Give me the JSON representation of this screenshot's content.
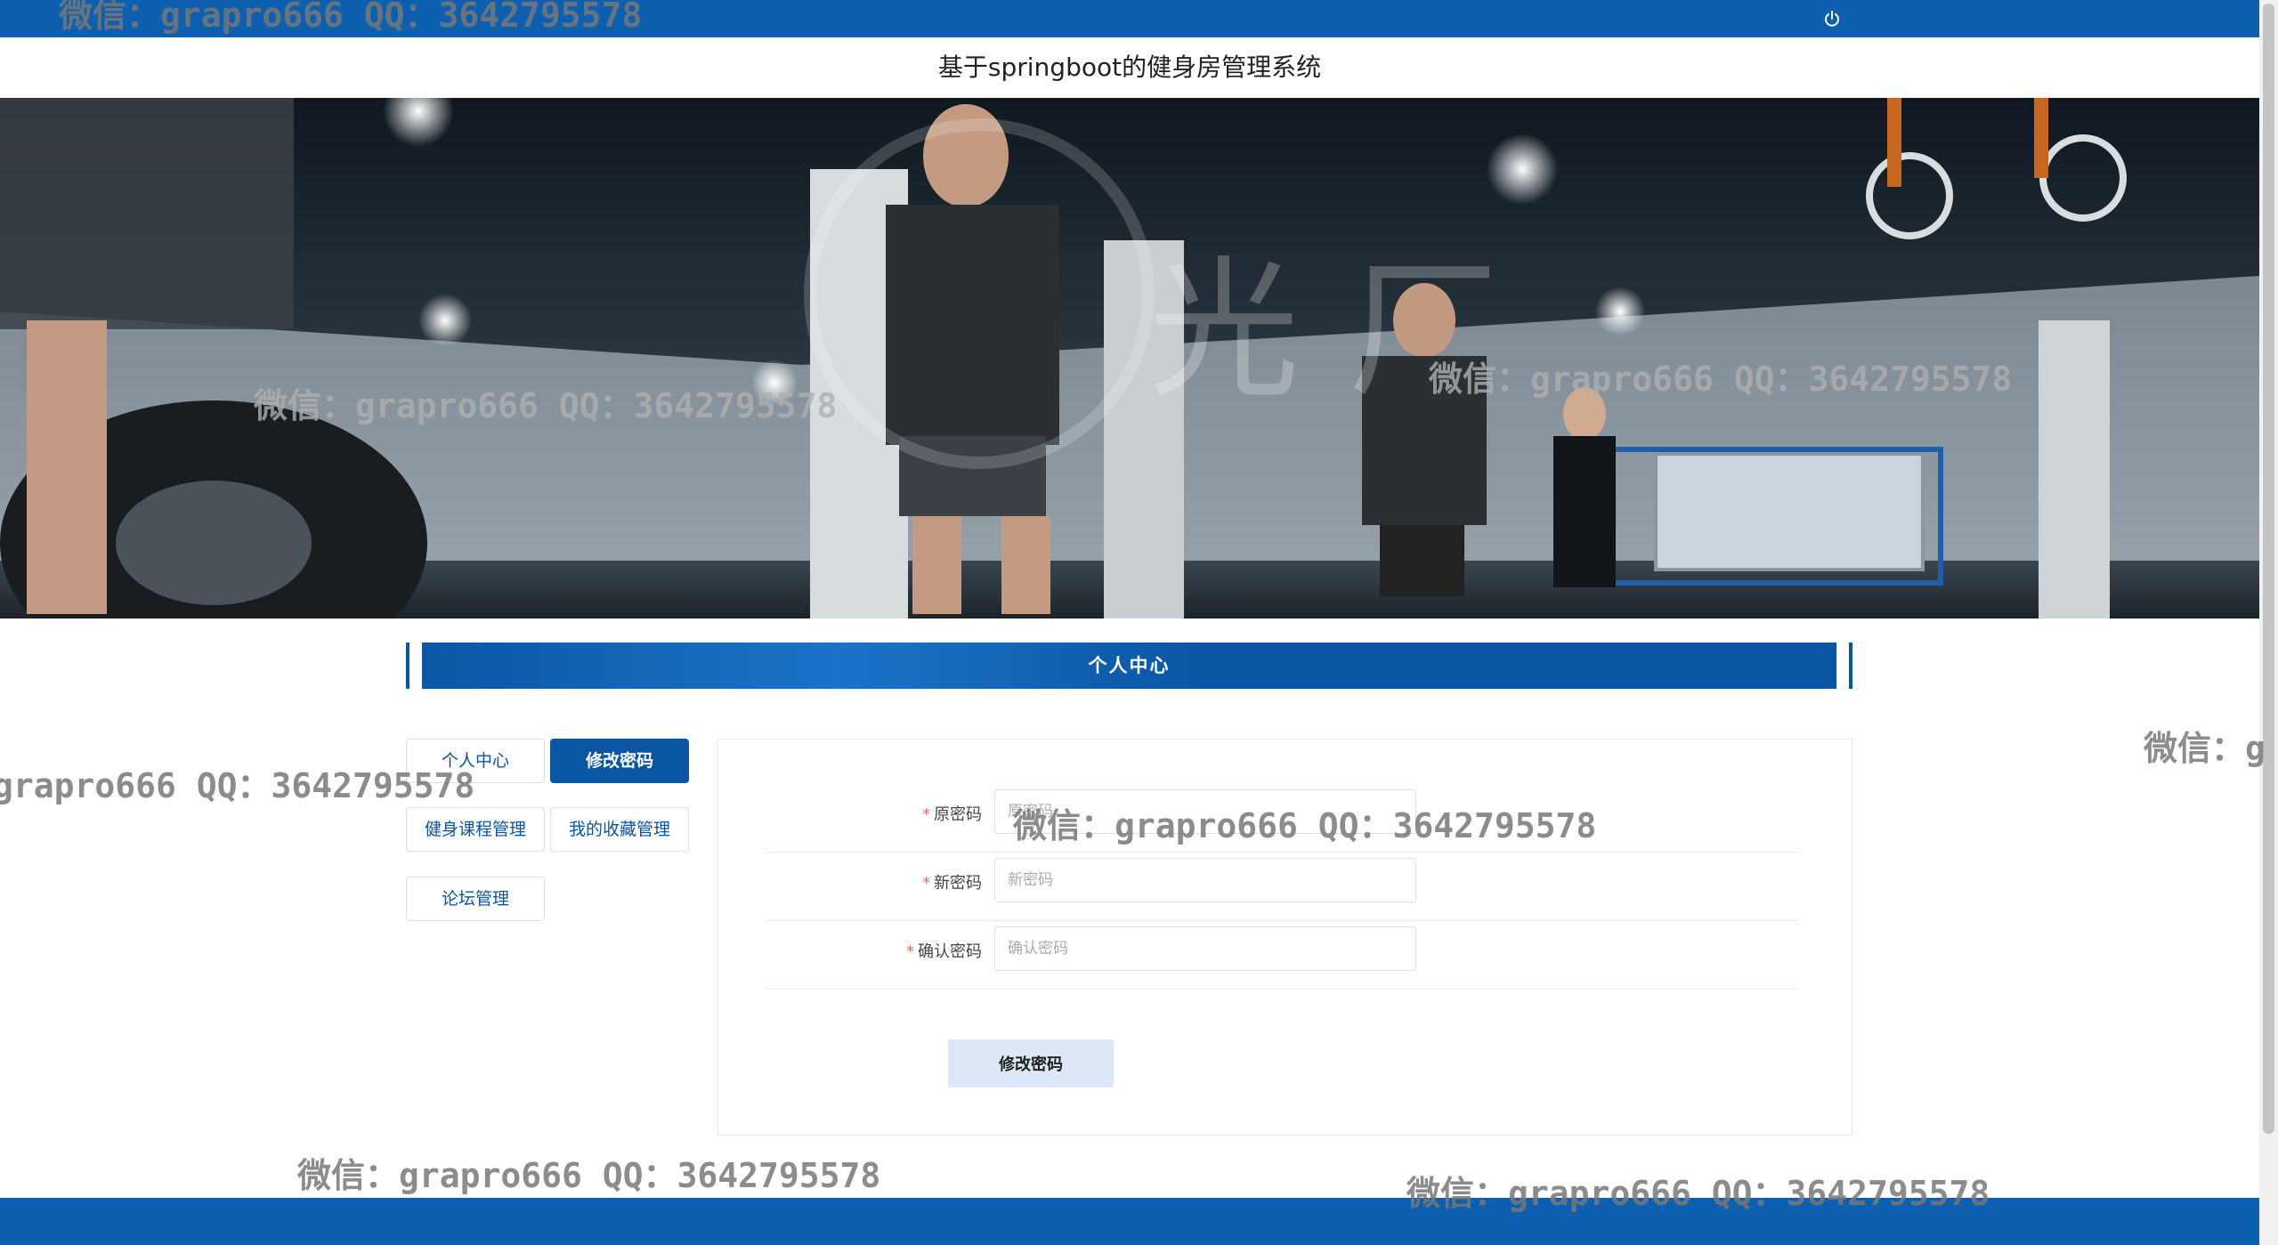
{
  "header": {
    "title": "基于springboot的健身房管理系统",
    "power_icon": "power-icon"
  },
  "banner": {
    "image_description_icon": "gym-banner"
  },
  "section": {
    "title": "个人中心"
  },
  "menu": {
    "items": [
      {
        "label": "个人中心",
        "active": false
      },
      {
        "label": "修改密码",
        "active": true
      },
      {
        "label": "健身课程管理",
        "active": false
      },
      {
        "label": "我的收藏管理",
        "active": false
      },
      {
        "label": "论坛管理",
        "active": false
      }
    ]
  },
  "form": {
    "fields": [
      {
        "label": "原密码",
        "placeholder": "原密码",
        "required": true
      },
      {
        "label": "新密码",
        "placeholder": "新密码",
        "required": true
      },
      {
        "label": "确认密码",
        "placeholder": "确认密码",
        "required": true
      }
    ],
    "submit_label": "修改密码"
  },
  "watermarks": [
    "微信：grapro666 QQ：3642795578",
    "微信：grapro666 QQ：3642795578",
    "微信：grapro666 QQ：3642795578",
    "grapro666 QQ：3642795578",
    "微信：grapro666 QQ：3642795578",
    "微信：grapro666 QQ：3642795578",
    "微信：grapro666 QQ：3642795578",
    "微信：g"
  ],
  "colors": {
    "primary": "#0d5fb0",
    "button_light": "#dce8f5",
    "required": "#f56c6c"
  }
}
